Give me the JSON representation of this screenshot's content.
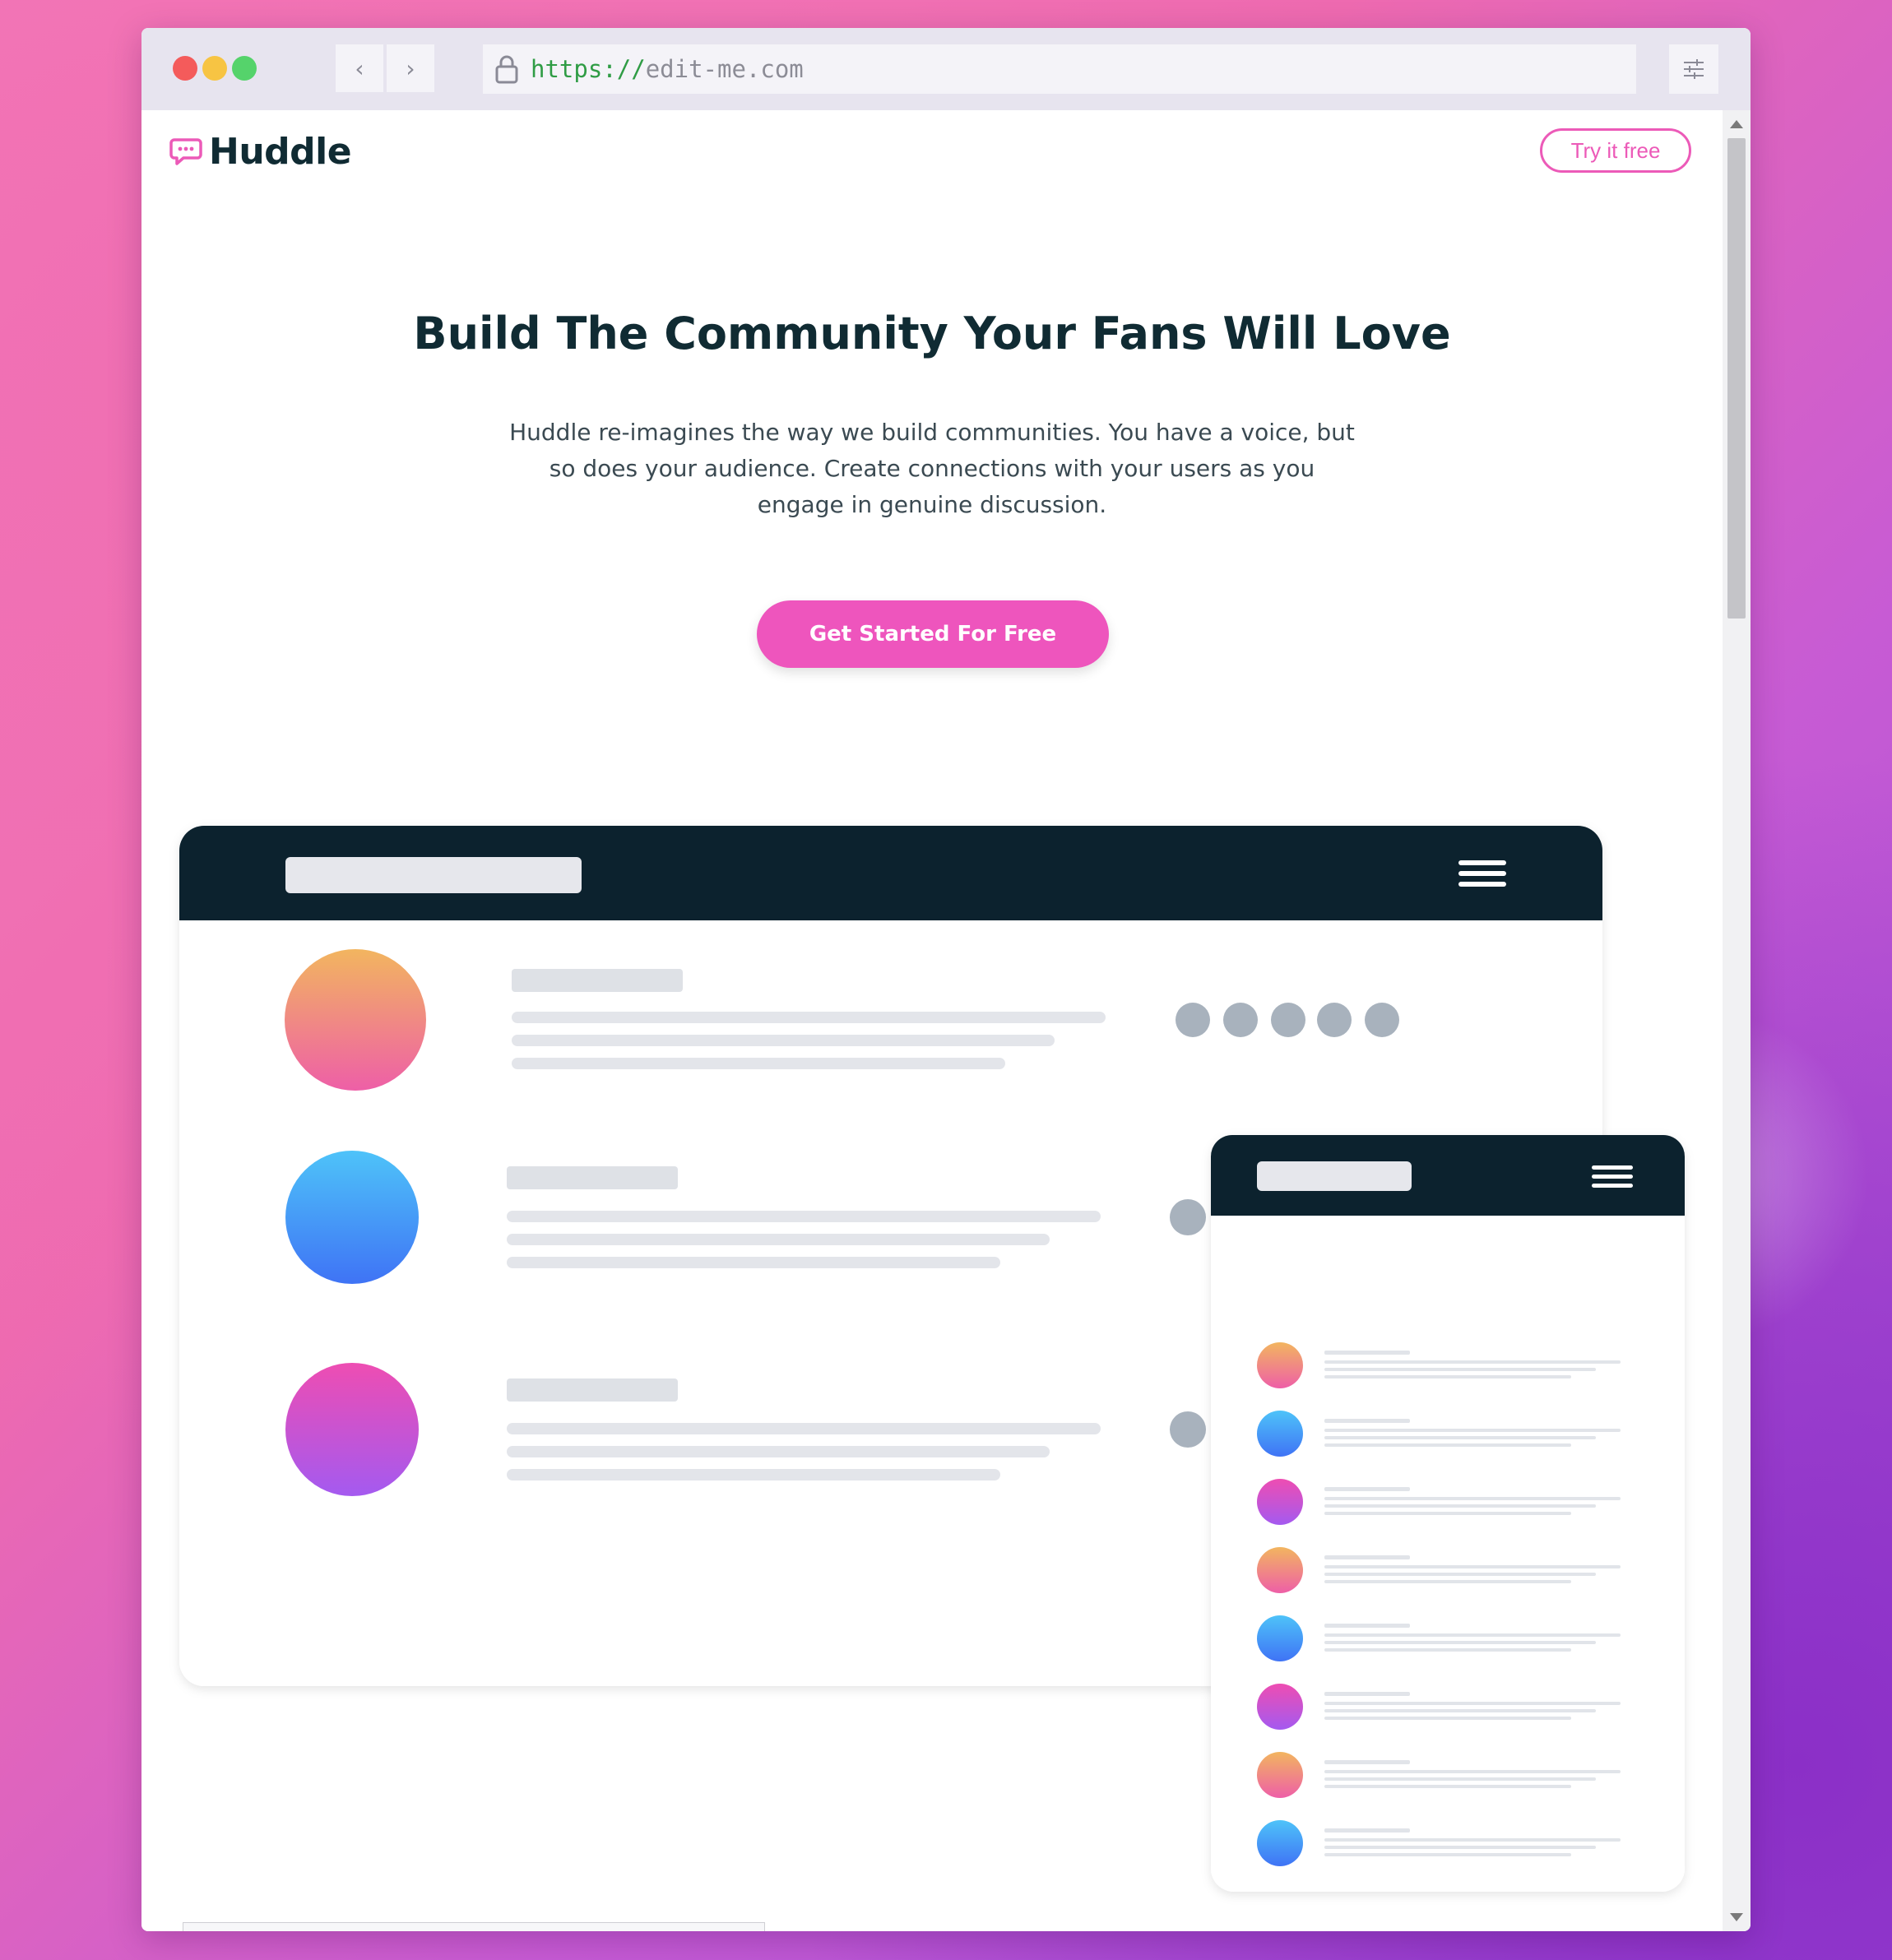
{
  "browser": {
    "url_scheme": "https://",
    "url_host": "edit-me.com",
    "back_glyph": "‹",
    "forward_glyph": "›"
  },
  "site": {
    "logo_text": "Huddle",
    "try_label": "Try it free",
    "accent_color": "#ec5ab8",
    "dark_color": "#0c222e"
  },
  "hero": {
    "title": "Build The Community Your Fans Will Love",
    "description": "Huddle re-imagines the way we build communities. You have a voice, but so does your audience. Create connections with your users as you engage in genuine discussion.",
    "cta_label": "Get Started For Free"
  },
  "illustration": {
    "desktop_rows": [
      "orange",
      "blue",
      "purple"
    ],
    "mobile_rows": [
      "orange",
      "blue",
      "purple",
      "orange",
      "blue",
      "purple",
      "orange",
      "blue"
    ],
    "member_dots": 5
  }
}
